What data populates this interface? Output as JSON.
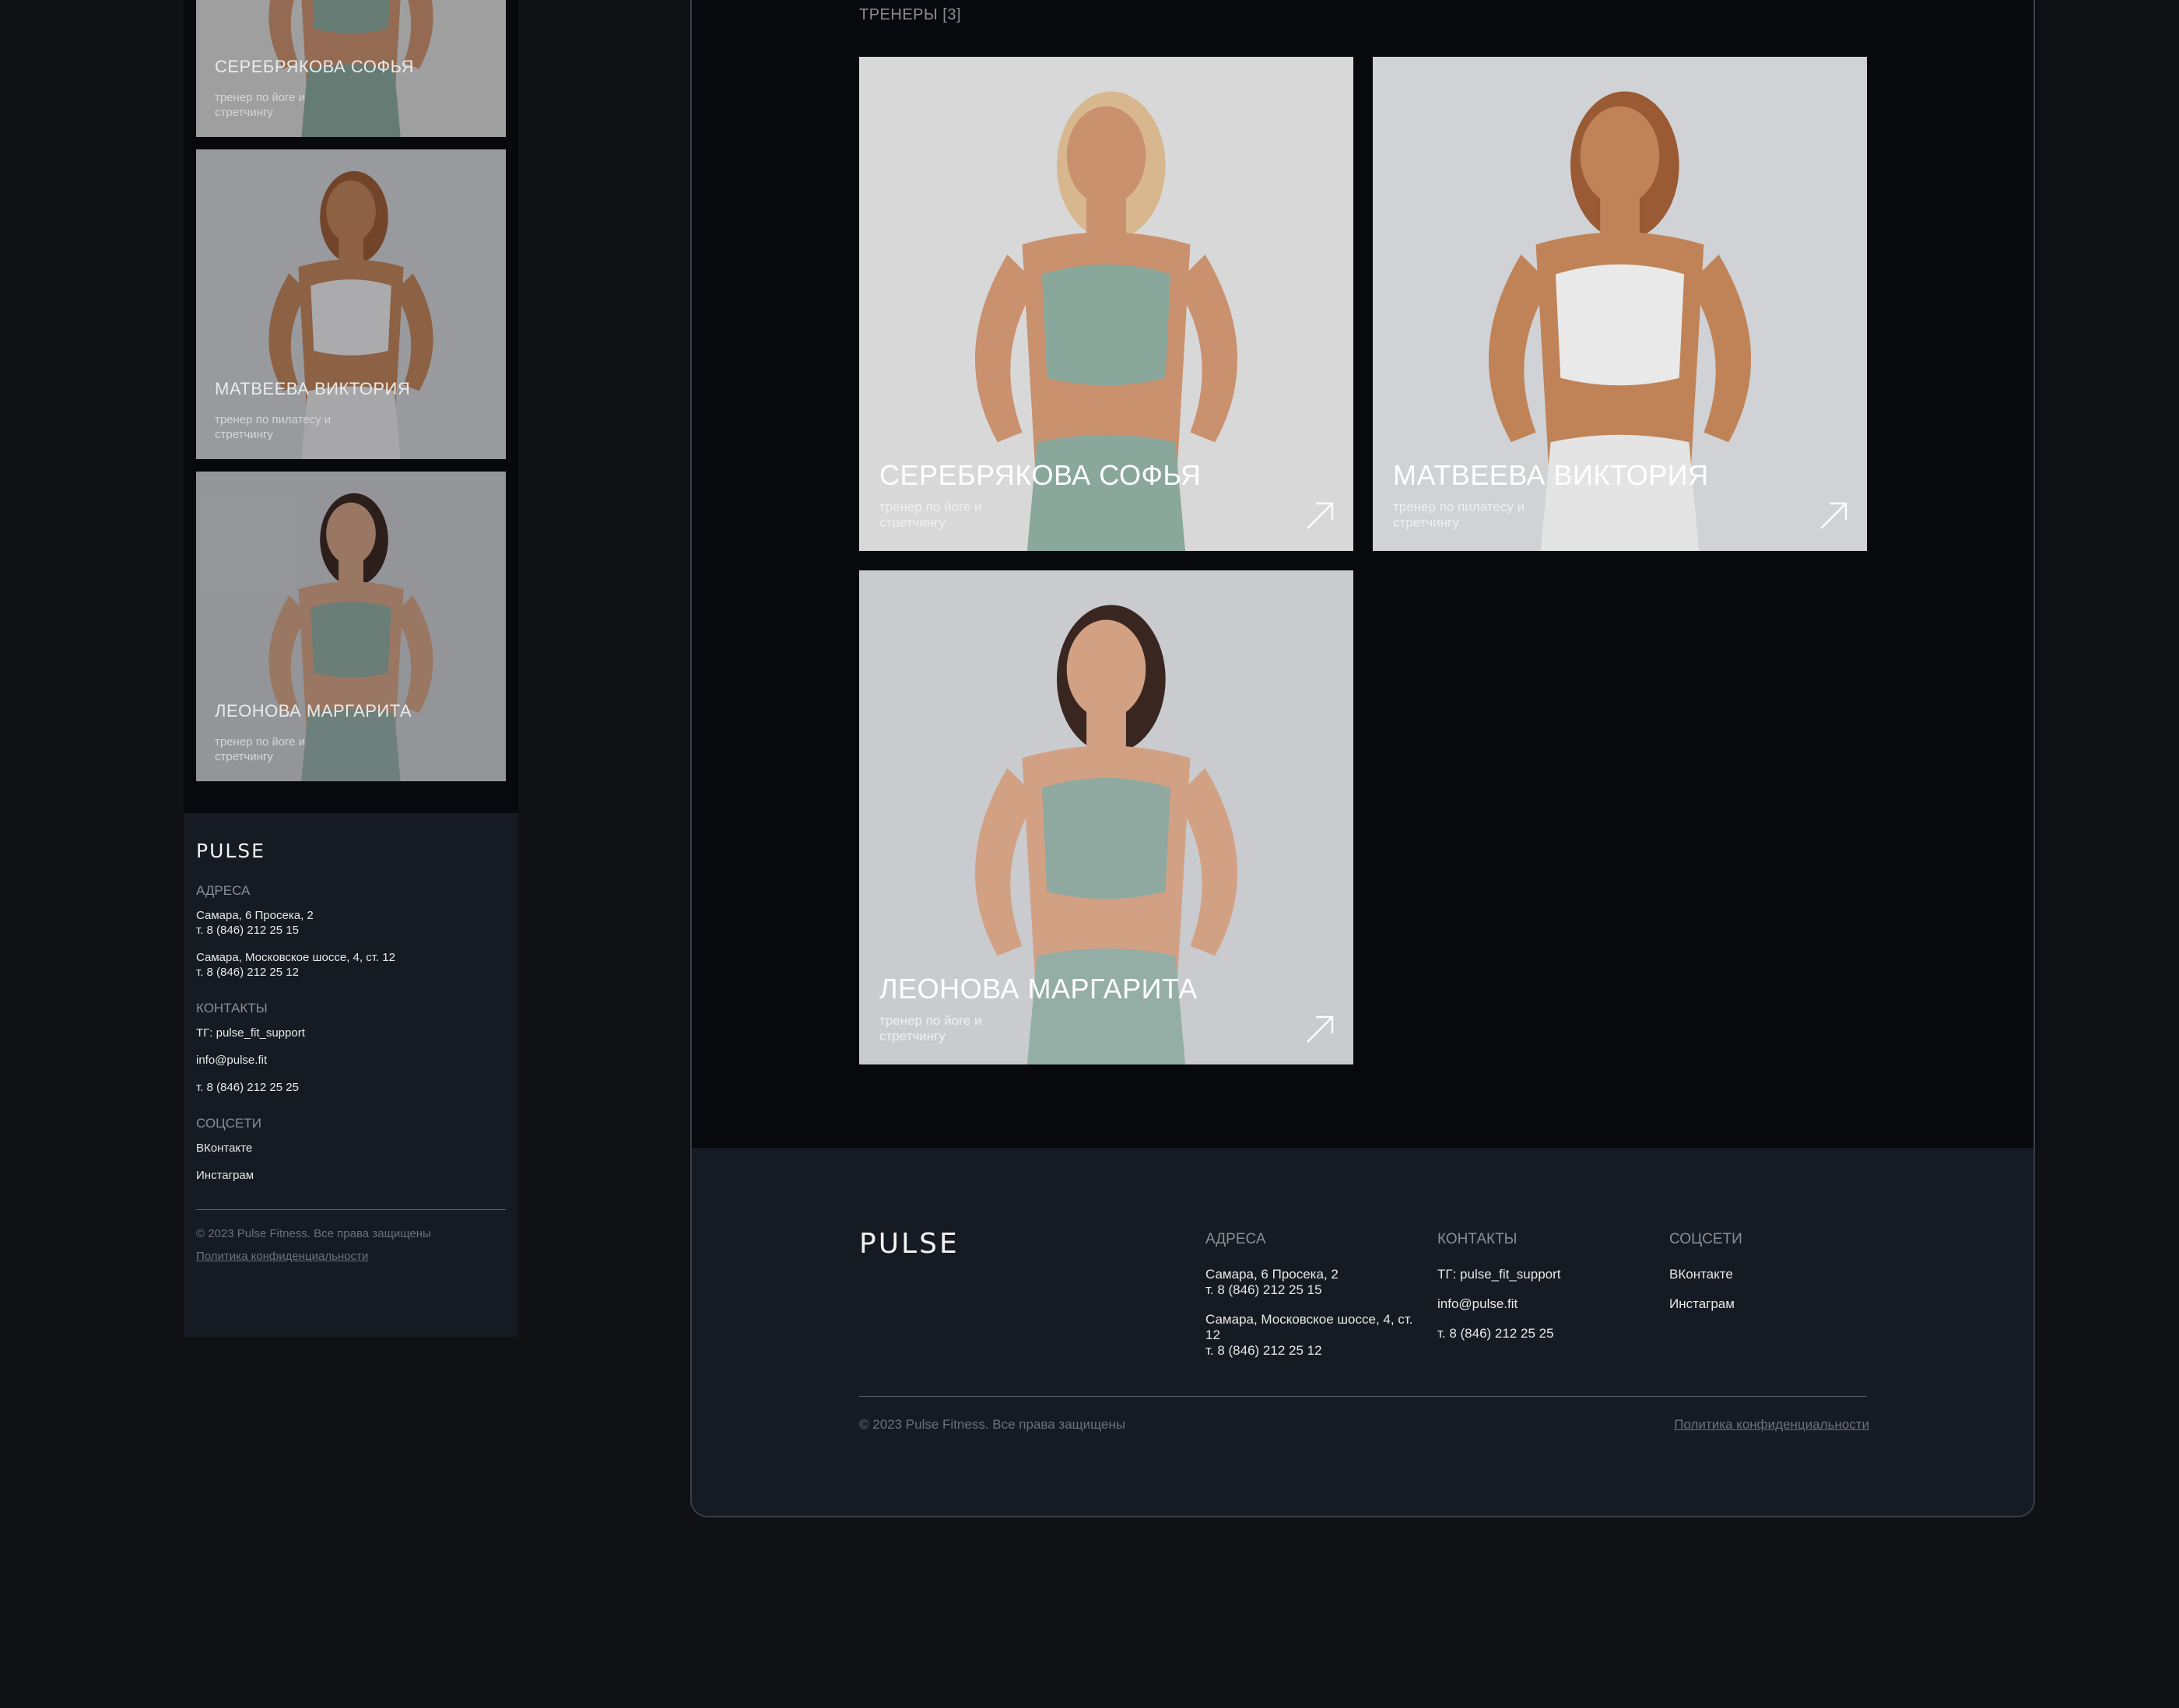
{
  "brand": {
    "logo": "PULSE"
  },
  "trainers_heading": "ТРЕНЕРЫ [3]",
  "trainers": [
    {
      "name": "СЕРЕБРЯКОВА СОФЬЯ",
      "role": "тренер по йоге и стретчингу",
      "bg": "#d8d8d9",
      "top": "#8aa79c",
      "bottom": "#8aa79c",
      "hair": "#d8b78e",
      "skin": "#c9916d"
    },
    {
      "name": "МАТВЕЕВА ВИКТОРИЯ",
      "role": "тренер по пилатесу и стретчингу",
      "bg": "#d0d2d5",
      "top": "#e9e9ea",
      "bottom": "#e4e4e5",
      "hair": "#9a5a34",
      "skin": "#c08358"
    },
    {
      "name": "ЛЕОНОВА МАРГАРИТА",
      "role": "тренер по йоге и стретчингу",
      "bg": "#c9cbcf",
      "top": "#8fa9a0",
      "bottom": "#95aea5",
      "hair": "#3a2620",
      "skin": "#d2a184"
    }
  ],
  "footer": {
    "addresses_title": "АДРЕСА",
    "addresses": [
      {
        "line1": "Самара, 6 Просека, 2",
        "phone": "т. 8 (846) 212 25 15"
      },
      {
        "line1": "Самара, Московское шоссе, 4, ст. 12",
        "phone": "т. 8 (846) 212 25 12"
      }
    ],
    "contacts_title": "КОНТАКТЫ",
    "contacts": [
      "ТГ: pulse_fit_support",
      "info@pulse.fit",
      "т. 8 (846) 212 25 25"
    ],
    "social_title": "СОЦСЕТИ",
    "social": [
      "ВКонтакте",
      "Инстаграм"
    ],
    "copyright": "© 2023 Pulse Fitness. Все права защищены",
    "copyright_mobile": "© 2023 Pulse Fitness. Все права защищены",
    "policy": "Политика конфиденциальности"
  }
}
